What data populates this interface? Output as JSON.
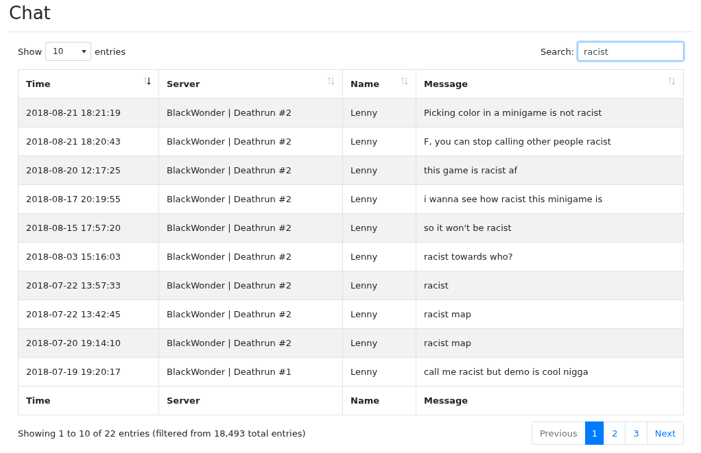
{
  "title": "Chat",
  "length": {
    "label_before": "Show",
    "value": "10",
    "label_after": "entries"
  },
  "search": {
    "label": "Search:",
    "value": "racist"
  },
  "table": {
    "columns": [
      {
        "label": "Time",
        "sorted": true
      },
      {
        "label": "Server",
        "sorted": false
      },
      {
        "label": "Name",
        "sorted": false
      },
      {
        "label": "Message",
        "sorted": false
      }
    ],
    "rows": [
      [
        "2018-08-21 18:21:19",
        "BlackWonder | Deathrun #2",
        "Lenny",
        "Picking color in a minigame is not racist"
      ],
      [
        "2018-08-21 18:20:43",
        "BlackWonder | Deathrun #2",
        "Lenny",
        "F, you can stop calling other people racist"
      ],
      [
        "2018-08-20 12:17:25",
        "BlackWonder | Deathrun #2",
        "Lenny",
        "this game is racist af"
      ],
      [
        "2018-08-17 20:19:55",
        "BlackWonder | Deathrun #2",
        "Lenny",
        "i wanna see how racist this minigame is"
      ],
      [
        "2018-08-15 17:57:20",
        "BlackWonder | Deathrun #2",
        "Lenny",
        "so it won't be racist"
      ],
      [
        "2018-08-03 15:16:03",
        "BlackWonder | Deathrun #2",
        "Lenny",
        "racist towards who?"
      ],
      [
        "2018-07-22 13:57:33",
        "BlackWonder | Deathrun #2",
        "Lenny",
        "racist"
      ],
      [
        "2018-07-22 13:42:45",
        "BlackWonder | Deathrun #2",
        "Lenny",
        "racist map"
      ],
      [
        "2018-07-20 19:14:10",
        "BlackWonder | Deathrun #2",
        "Lenny",
        "racist map"
      ],
      [
        "2018-07-19 19:20:17",
        "BlackWonder | Deathrun #1",
        "Lenny",
        "call me racist but demo is cool nigga"
      ]
    ],
    "footer": [
      "Time",
      "Server",
      "Name",
      "Message"
    ]
  },
  "info": "Showing 1 to 10 of 22 entries (filtered from 18,493 total entries)",
  "pagination": [
    {
      "label": "Previous",
      "disabled": true,
      "selected": false
    },
    {
      "label": "1",
      "disabled": false,
      "selected": true
    },
    {
      "label": "2",
      "disabled": false,
      "selected": false
    },
    {
      "label": "3",
      "disabled": false,
      "selected": false
    },
    {
      "label": "Next",
      "disabled": false,
      "selected": false
    }
  ]
}
